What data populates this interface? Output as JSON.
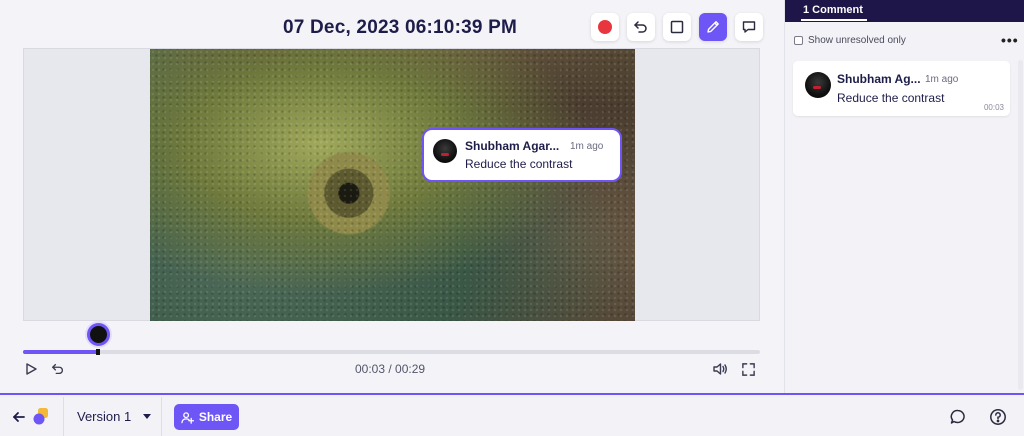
{
  "header": {
    "timestamp": "07 Dec, 2023 06:10:39 PM"
  },
  "toolbar": {
    "tools": [
      {
        "name": "record",
        "icon": "record-dot-icon",
        "active": false
      },
      {
        "name": "undo",
        "icon": "undo-icon",
        "active": false
      },
      {
        "name": "rectangle",
        "icon": "square-icon",
        "active": false
      },
      {
        "name": "draw",
        "icon": "pencil-icon",
        "active": true
      },
      {
        "name": "comment",
        "icon": "speech-bubble-icon",
        "active": false
      }
    ],
    "colors": {
      "record": "#e8363f",
      "active": "#6e55f5"
    }
  },
  "video": {
    "annotation": {
      "author": "Shubham Agar...",
      "time_ago": "1m ago",
      "text": "Reduce the contrast"
    },
    "progress": 0.103,
    "current_time": "00:03",
    "duration": "00:29",
    "time_display": "00:03 / 00:29"
  },
  "panel": {
    "tab_label": "1 Comment",
    "filter_label": "Show unresolved only",
    "more_label": "•••",
    "comments": [
      {
        "author": "Shubham Ag...",
        "time_ago": "1m ago",
        "text": "Reduce the contrast",
        "stamp": "00:03"
      }
    ]
  },
  "bottom": {
    "version_label": "Version 1",
    "share_label": "Share",
    "accent": "#6e55f5"
  }
}
